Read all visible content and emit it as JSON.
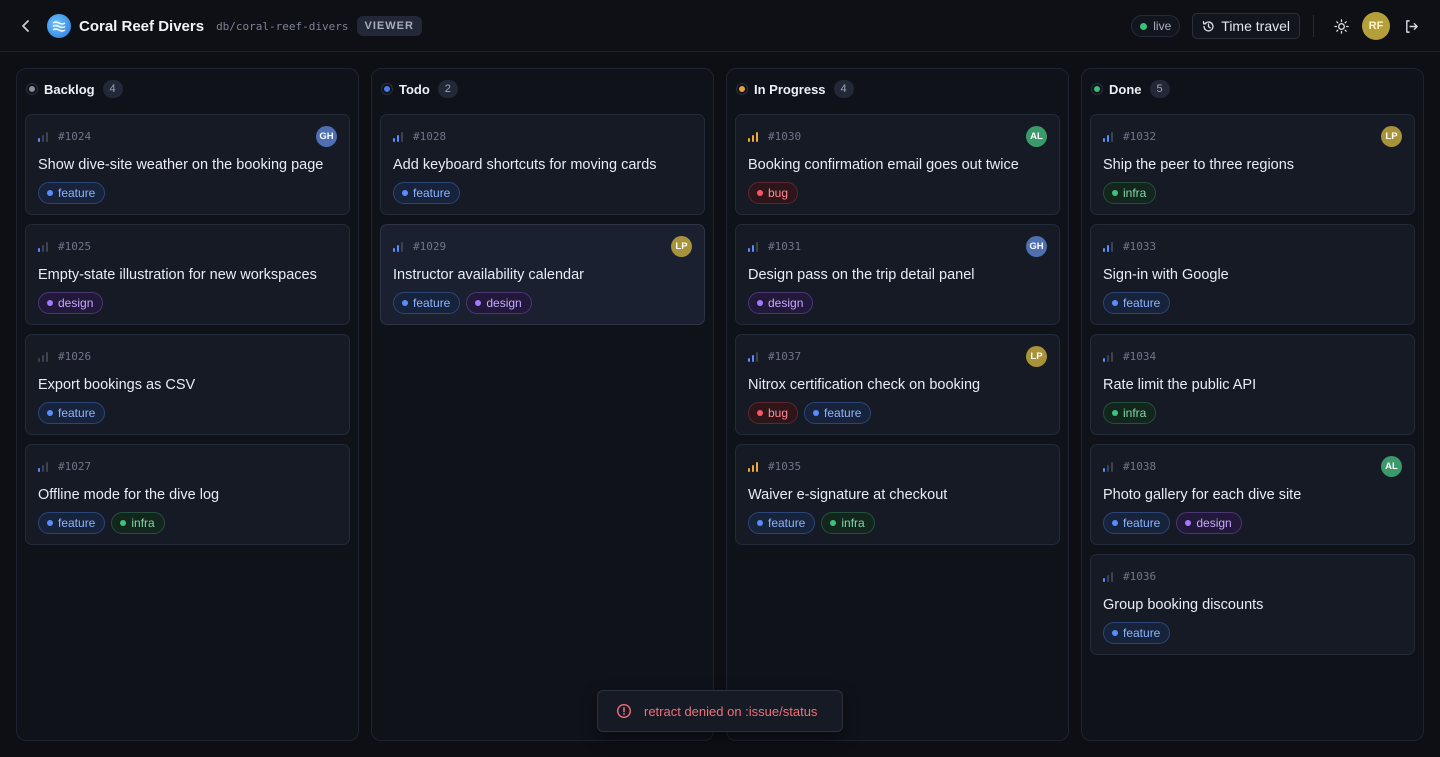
{
  "header": {
    "title": "Coral Reef Divers",
    "db_path": "db/coral-reef-divers",
    "role": "VIEWER",
    "live_label": "live",
    "time_travel_label": "Time travel",
    "user_initials": "RF"
  },
  "columns": [
    {
      "name": "Backlog",
      "count": "4",
      "color": "#8a8f9c",
      "cards": [
        {
          "id": "#1024",
          "title": "Show dive-site weather on the booking page",
          "priority": 1,
          "assignee": "GH",
          "assignee_color": "#4f6fb0",
          "tags": [
            "feature"
          ]
        },
        {
          "id": "#1025",
          "title": "Empty-state illustration for new workspaces",
          "priority": 1,
          "assignee": "",
          "assignee_color": "",
          "tags": [
            "design"
          ]
        },
        {
          "id": "#1026",
          "title": "Export bookings as CSV",
          "priority": 0,
          "assignee": "",
          "assignee_color": "",
          "tags": [
            "feature"
          ]
        },
        {
          "id": "#1027",
          "title": "Offline mode for the dive log",
          "priority": 1,
          "assignee": "",
          "assignee_color": "",
          "tags": [
            "feature",
            "infra"
          ]
        }
      ]
    },
    {
      "name": "Todo",
      "count": "2",
      "color": "#4a7cf0",
      "cards": [
        {
          "id": "#1028",
          "title": "Add keyboard shortcuts for moving cards",
          "priority": 2,
          "assignee": "",
          "assignee_color": "",
          "tags": [
            "feature"
          ]
        },
        {
          "id": "#1029",
          "title": "Instructor availability calendar",
          "priority": 2,
          "assignee": "LP",
          "assignee_color": "#a8923a",
          "tags": [
            "feature",
            "design"
          ],
          "highlight": true
        }
      ]
    },
    {
      "name": "In Progress",
      "count": "4",
      "color": "#e9a23b",
      "cards": [
        {
          "id": "#1030",
          "title": "Booking confirmation email goes out twice",
          "priority": 3,
          "assignee": "AL",
          "assignee_color": "#3a9a6a",
          "tags": [
            "bug"
          ]
        },
        {
          "id": "#1031",
          "title": "Design pass on the trip detail panel",
          "priority": 2,
          "assignee": "GH",
          "assignee_color": "#4f6fb0",
          "tags": [
            "design"
          ]
        },
        {
          "id": "#1037",
          "title": "Nitrox certification check on booking",
          "priority": 2,
          "assignee": "LP",
          "assignee_color": "#a8923a",
          "tags": [
            "bug",
            "feature"
          ]
        },
        {
          "id": "#1035",
          "title": "Waiver e-signature at checkout",
          "priority": 3,
          "assignee": "",
          "assignee_color": "",
          "tags": [
            "feature",
            "infra"
          ]
        }
      ]
    },
    {
      "name": "Done",
      "count": "5",
      "color": "#36c27b",
      "cards": [
        {
          "id": "#1032",
          "title": "Ship the peer to three regions",
          "priority": 2,
          "assignee": "LP",
          "assignee_color": "#a8923a",
          "tags": [
            "infra"
          ]
        },
        {
          "id": "#1033",
          "title": "Sign-in with Google",
          "priority": 2,
          "assignee": "",
          "assignee_color": "",
          "tags": [
            "feature"
          ]
        },
        {
          "id": "#1034",
          "title": "Rate limit the public API",
          "priority": 1,
          "assignee": "",
          "assignee_color": "",
          "tags": [
            "infra"
          ]
        },
        {
          "id": "#1038",
          "title": "Photo gallery for each dive site",
          "priority": 1,
          "assignee": "AL",
          "assignee_color": "#3a9a6a",
          "tags": [
            "feature",
            "design"
          ]
        },
        {
          "id": "#1036",
          "title": "Group booking discounts",
          "priority": 1,
          "assignee": "",
          "assignee_color": "",
          "tags": [
            "feature"
          ]
        }
      ]
    }
  ],
  "toast": {
    "message": "retract denied on :issue/status"
  },
  "icons": {
    "back": "chevron-left-icon",
    "logo": "waves-logo-icon",
    "time_travel": "history-clock-icon",
    "theme": "sun-icon",
    "logout": "logout-icon",
    "toast": "alert-circle-icon",
    "priority": "signal-bars-icon"
  },
  "colors": {
    "accent_live": "#36c27b",
    "error": "#f0707a"
  }
}
